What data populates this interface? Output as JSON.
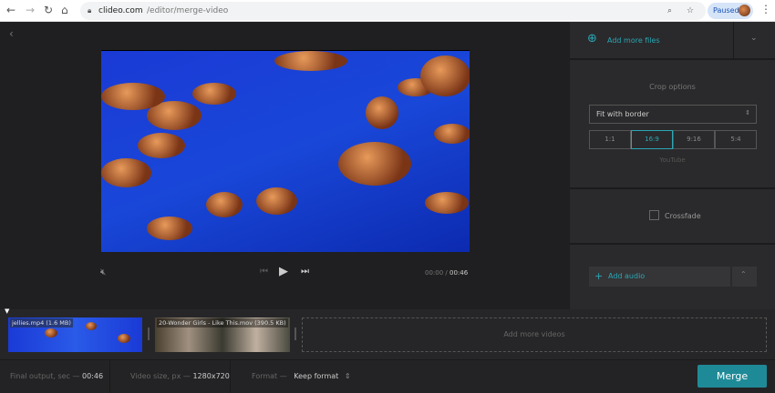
{
  "browser": {
    "url_host": "clideo.com",
    "url_path": "/editor/merge-video",
    "profile_status": "Paused"
  },
  "player": {
    "current_time": "00:00",
    "separator": "/",
    "duration": "00:46"
  },
  "sidebar": {
    "add_files_label": "Add more files",
    "crop_title": "Crop options",
    "crop_select": "Fit with border",
    "ratios": [
      {
        "label": "1:1"
      },
      {
        "label": "16:9",
        "active": true
      },
      {
        "label": "9:16"
      },
      {
        "label": "5:4"
      }
    ],
    "ratio_hint": "YouTube",
    "crossfade_label": "Crossfade",
    "add_audio_label": "Add audio"
  },
  "timeline": {
    "clips": [
      {
        "label": "jellies.mp4 (1.6 MB)"
      },
      {
        "label": "20-Wonder Girls - Like This.mov (390.5 KB)"
      }
    ],
    "add_more_label": "Add more videos"
  },
  "footer": {
    "output_label": "Final output, sec —",
    "output_value": "00:46",
    "size_label": "Video size, px —",
    "size_value": "1280x720",
    "format_label": "Format —",
    "format_value": "Keep format",
    "merge_label": "Merge"
  },
  "colors": {
    "accent": "#2aa7b5",
    "merge": "#1f8a97"
  }
}
